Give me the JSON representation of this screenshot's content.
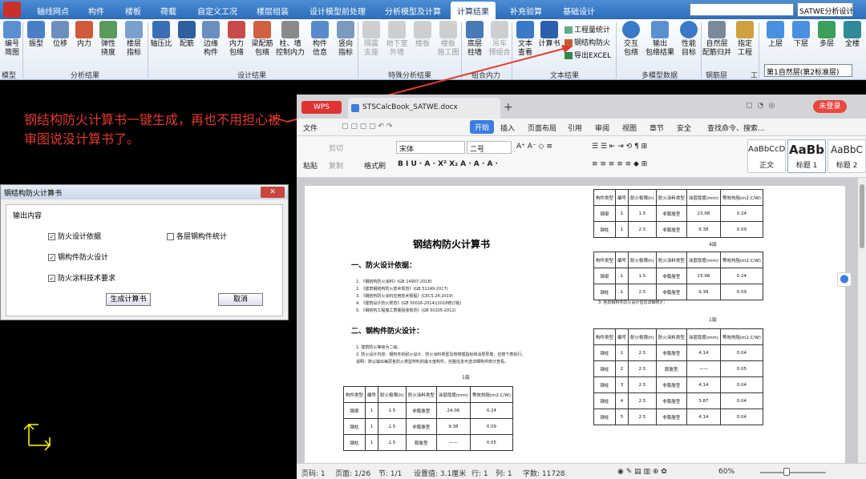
{
  "ribbon": {
    "tabs": [
      "轴线网点",
      "构件",
      "楼板",
      "荷载",
      "自定义工况",
      "楼层组装",
      "设计模型前处理",
      "分析模型及计算",
      "计算结果",
      "补充验算",
      "基础设计"
    ],
    "active_tab": "计算结果",
    "analysis_select": "SATWE分析设计",
    "buttons": [
      {
        "label": "编号\n简图",
        "dim": false
      },
      {
        "label": "振型",
        "dim": false
      },
      {
        "label": "位移",
        "dim": false
      },
      {
        "label": "内力",
        "dim": false
      },
      {
        "label": "弹性\n挠度",
        "dim": false
      },
      {
        "label": "楼层\n指标",
        "dim": false
      },
      {
        "label": "轴压比",
        "dim": false
      },
      {
        "label": "配筋",
        "dim": false
      },
      {
        "label": "边缘\n构件",
        "dim": false
      },
      {
        "label": "内力\n包络",
        "dim": false
      },
      {
        "label": "梁配筋\n包络",
        "dim": false
      },
      {
        "label": "柱、墙\n控制内力",
        "dim": false
      },
      {
        "label": "构件\n信息",
        "dim": false
      },
      {
        "label": "竖向\n指标",
        "dim": false
      },
      {
        "label": "隔震\n支座",
        "dim": true
      },
      {
        "label": "地下室\n外墙",
        "dim": true
      },
      {
        "label": "楼板",
        "dim": true
      },
      {
        "label": "楼板\n施工图",
        "dim": true
      },
      {
        "label": "底层\n柱墙",
        "dim": false
      },
      {
        "label": "吊车\n预组合",
        "dim": true
      },
      {
        "label": "文本\n查看",
        "dim": false
      },
      {
        "label": "计算书",
        "dim": false
      },
      {
        "label": "交互\n包络",
        "dim": false
      },
      {
        "label": "输出\n包络结果",
        "dim": false
      },
      {
        "label": "性能\n目标",
        "dim": false
      },
      {
        "label": "自然层\n配筋归并",
        "dim": false
      },
      {
        "label": "指定\n工程",
        "dim": false
      },
      {
        "label": "上层",
        "dim": false
      },
      {
        "label": "下层",
        "dim": false
      },
      {
        "label": "多层",
        "dim": false
      },
      {
        "label": "全楼",
        "dim": false
      }
    ],
    "small_buttons": [
      "工程量统计",
      "钢结构防火",
      "导出EXCEL"
    ],
    "groups": [
      "模型",
      "分析结果",
      "设计结果",
      "特殊分析结果",
      "组合内力",
      "文本结果",
      "多模型数据",
      "钢筋层",
      "工"
    ],
    "floor_select": "第1自然层(第2标准层)"
  },
  "annotation": {
    "text": "钢结构防火计算书一键生成，再也不用担心被审图说没计算书了。",
    "color": "#e23b2e"
  },
  "dialog": {
    "title": "钢结构防火计算书",
    "close_label": "✕",
    "group_label": "输出内容",
    "checkboxes": [
      {
        "label": "防火设计依据",
        "checked": true
      },
      {
        "label": "各层钢构件统计",
        "checked": false
      },
      {
        "label": "钢构件防火设计",
        "checked": true
      },
      {
        "label": "防火涂料技术要求",
        "checked": true
      }
    ],
    "generate_label": "生成计算书",
    "cancel_label": "取消"
  },
  "wps": {
    "app_label": "WPS",
    "doc_tab": "STSCalcBook_SATWE.docx",
    "new_tab": "+",
    "login": "未登录",
    "menu": [
      "文件",
      "开始",
      "插入",
      "页面布局",
      "引用",
      "审阅",
      "视图",
      "章节",
      "安全"
    ],
    "active_menu": "开始",
    "search": "查找命令、搜索...",
    "clipboard": [
      "剪切",
      "复制",
      "粘贴",
      "格式刷"
    ],
    "font_name": "宋体",
    "font_size": "二号",
    "styles": [
      {
        "sample": "AaBbCcDd",
        "name": "正文"
      },
      {
        "sample": "AaBb",
        "name": "标题 1"
      },
      {
        "sample": "AaBbC",
        "name": "标题 2"
      }
    ],
    "doc": {
      "title": "钢结构防火计算书",
      "h_basis": "一、防火设计依据：",
      "references": [
        "1. 《钢结构防火涂料》(GB 14907-2018)",
        "2. 《建筑钢结构防火技术规范》(GB 51249-2017)",
        "3. 《钢结构防火涂料应用技术规程》(CECS 24:2019)",
        "4. 《建筑设计防火规范》(GB 50016-2014)(2018修订版)",
        "5. 《钢结构工程施工质量验收规范》(GB 50205-2012)"
      ],
      "h_design": "二、钢构件防火设计：",
      "design_notes": [
        "1. 建筑防火等级为二级。",
        "2. 防火设计内容：钢构件的耐火设计、防火涂料类型及热物理指标和涂层厚度，应按下表执行。",
        "   说明：默认输出每层各防火类型材料的最大值构件，完整信息可选详细构件统计查看。"
      ],
      "floor_1": "1层",
      "floor_4": "4层",
      "floor_1b": "1层",
      "section3": "3. 各层钢构件防火设计信息详细统计：",
      "headers": [
        "构件类型",
        "编号",
        "耐火极限(h)",
        "防火涂料类型",
        "涂层厚度(mm)",
        "等效热阻(m2.C/W)"
      ],
      "table_main": [
        [
          "钢梁",
          "1",
          "1.5",
          "非膨胀型",
          "24.06",
          "0.24"
        ],
        [
          "钢柱",
          "1",
          "2.5",
          "非膨胀型",
          "9.38",
          "0.09"
        ],
        [
          "钢柱",
          "1",
          "2.5",
          "膨胀型",
          "——",
          "0.05"
        ]
      ],
      "table_top": [
        [
          "钢梁",
          "1",
          "1.5",
          "非膨胀型",
          "23.98",
          "0.24"
        ],
        [
          "钢柱",
          "1",
          "2.5",
          "非膨胀型",
          "9.38",
          "0.09"
        ]
      ],
      "table_mid": [
        [
          "钢梁",
          "1",
          "1.5",
          "非膨胀型",
          "23.98",
          "0.24"
        ],
        [
          "钢柱",
          "1",
          "2.5",
          "非膨胀型",
          "9.38",
          "0.09"
        ]
      ],
      "table_bottom": [
        [
          "钢柱",
          "1",
          "2.5",
          "非膨胀型",
          "4.14",
          "0.04"
        ],
        [
          "钢柱",
          "2",
          "2.5",
          "膨胀型",
          "——",
          "0.05"
        ],
        [
          "钢柱",
          "3",
          "2.5",
          "非膨胀型",
          "4.14",
          "0.04"
        ],
        [
          "钢柱",
          "4",
          "2.5",
          "非膨胀型",
          "3.87",
          "0.04"
        ],
        [
          "钢柱",
          "5",
          "2.5",
          "非膨胀型",
          "4.14",
          "0.04"
        ]
      ]
    },
    "status": {
      "page_no": "页码: 1",
      "pages": "页面: 1/26",
      "section": "节: 1/1",
      "setting": "设置值: 3.1厘米",
      "row": "行: 1",
      "col": "列: 1",
      "words": "字数: 11728",
      "zoom": "60%"
    }
  }
}
